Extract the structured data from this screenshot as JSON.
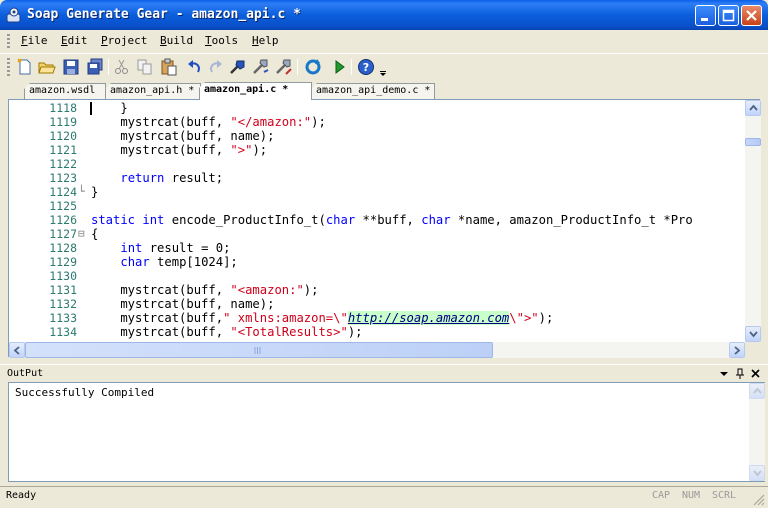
{
  "window": {
    "title": "Soap Generate Gear - amazon_api.c *",
    "app_icon": "soap-gear-app-icon",
    "controls": [
      "minimize-icon",
      "maximize-icon",
      "close-icon"
    ]
  },
  "menubar": {
    "items": [
      {
        "mnemonic": "F",
        "rest": "ile"
      },
      {
        "mnemonic": "E",
        "rest": "dit"
      },
      {
        "mnemonic": "P",
        "rest": "roject"
      },
      {
        "mnemonic": "B",
        "rest": "uild"
      },
      {
        "mnemonic": "T",
        "rest": "ools"
      },
      {
        "mnemonic": "H",
        "rest": "elp"
      }
    ]
  },
  "toolbar": {
    "buttons": [
      "new-file-icon",
      "open-folder-icon",
      "save-icon",
      "save-all-icon",
      "cut-icon",
      "copy-icon",
      "paste-icon",
      "undo-icon",
      "redo-icon",
      "build-icon",
      "tools-icon",
      "rebuild-icon",
      "refresh-icon",
      "run-icon",
      "help-icon",
      "toolbar-options-icon"
    ]
  },
  "tabs": [
    {
      "label": "amazon.wsdl",
      "active": false
    },
    {
      "label": "amazon_api.h *",
      "active": false
    },
    {
      "label": "amazon_api.c *",
      "active": true
    },
    {
      "label": "amazon_api_demo.c *",
      "active": false
    }
  ],
  "editor": {
    "line_numbers": [
      "1118",
      "1119",
      "1120",
      "1121",
      "1122",
      "1123",
      "1124",
      "1125",
      "1126",
      "1127",
      "1128",
      "1129",
      "1130",
      "1131",
      "1132",
      "1133",
      "1134"
    ],
    "fold_markers": {
      "1124": "└",
      "1127": "⊟"
    },
    "lines": [
      [
        {
          "t": "    }"
        }
      ],
      [
        {
          "t": "    mystrcat(buff, "
        },
        {
          "t": "\"</amazon:\"",
          "c": "str"
        },
        {
          "t": ");"
        }
      ],
      [
        {
          "t": "    mystrcat(buff, name);"
        }
      ],
      [
        {
          "t": "    mystrcat(buff, "
        },
        {
          "t": "\">\"",
          "c": "str"
        },
        {
          "t": ");"
        }
      ],
      [
        {
          "t": ""
        }
      ],
      [
        {
          "t": "    "
        },
        {
          "t": "return",
          "c": "kw"
        },
        {
          "t": " result;"
        }
      ],
      [
        {
          "t": "}"
        }
      ],
      [
        {
          "t": ""
        }
      ],
      [
        {
          "t": "static",
          "c": "kw"
        },
        {
          "t": " "
        },
        {
          "t": "int",
          "c": "kw"
        },
        {
          "t": " encode_ProductInfo_t("
        },
        {
          "t": "char",
          "c": "kw"
        },
        {
          "t": " **buff, "
        },
        {
          "t": "char",
          "c": "kw"
        },
        {
          "t": " *name, amazon_ProductInfo_t *Pro"
        }
      ],
      [
        {
          "t": "{"
        }
      ],
      [
        {
          "t": "    "
        },
        {
          "t": "int",
          "c": "kw"
        },
        {
          "t": " result = 0;"
        }
      ],
      [
        {
          "t": "    "
        },
        {
          "t": "char",
          "c": "kw"
        },
        {
          "t": " temp[1024];"
        }
      ],
      [
        {
          "t": ""
        }
      ],
      [
        {
          "t": "    mystrcat(buff, "
        },
        {
          "t": "\"<amazon:\"",
          "c": "str"
        },
        {
          "t": ");"
        }
      ],
      [
        {
          "t": "    mystrcat(buff, name);"
        }
      ],
      [
        {
          "t": "    mystrcat(buff,"
        },
        {
          "t": "\" xmlns:amazon=\\\"",
          "c": "str"
        },
        {
          "t": "http://soap.amazon.com",
          "c": "url"
        },
        {
          "t": "\\\">\"",
          "c": "str"
        },
        {
          "t": ");"
        }
      ],
      [
        {
          "t": "    mystrcat(buff, "
        },
        {
          "t": "\"<TotalResults>\"",
          "c": "str"
        },
        {
          "t": ");"
        }
      ]
    ],
    "colors": {
      "keyword": "#0000ff",
      "string": "#d0001b",
      "line_number": "#2b7a6f",
      "url_highlight": "#c9ffc9"
    }
  },
  "output": {
    "title": "OutPut",
    "text": "Successfully Compiled",
    "controls": [
      "dropdown-icon",
      "pin-icon",
      "close-icon"
    ]
  },
  "statusbar": {
    "text": "Ready",
    "indicators": [
      "CAP",
      "NUM",
      "SCRL"
    ]
  }
}
